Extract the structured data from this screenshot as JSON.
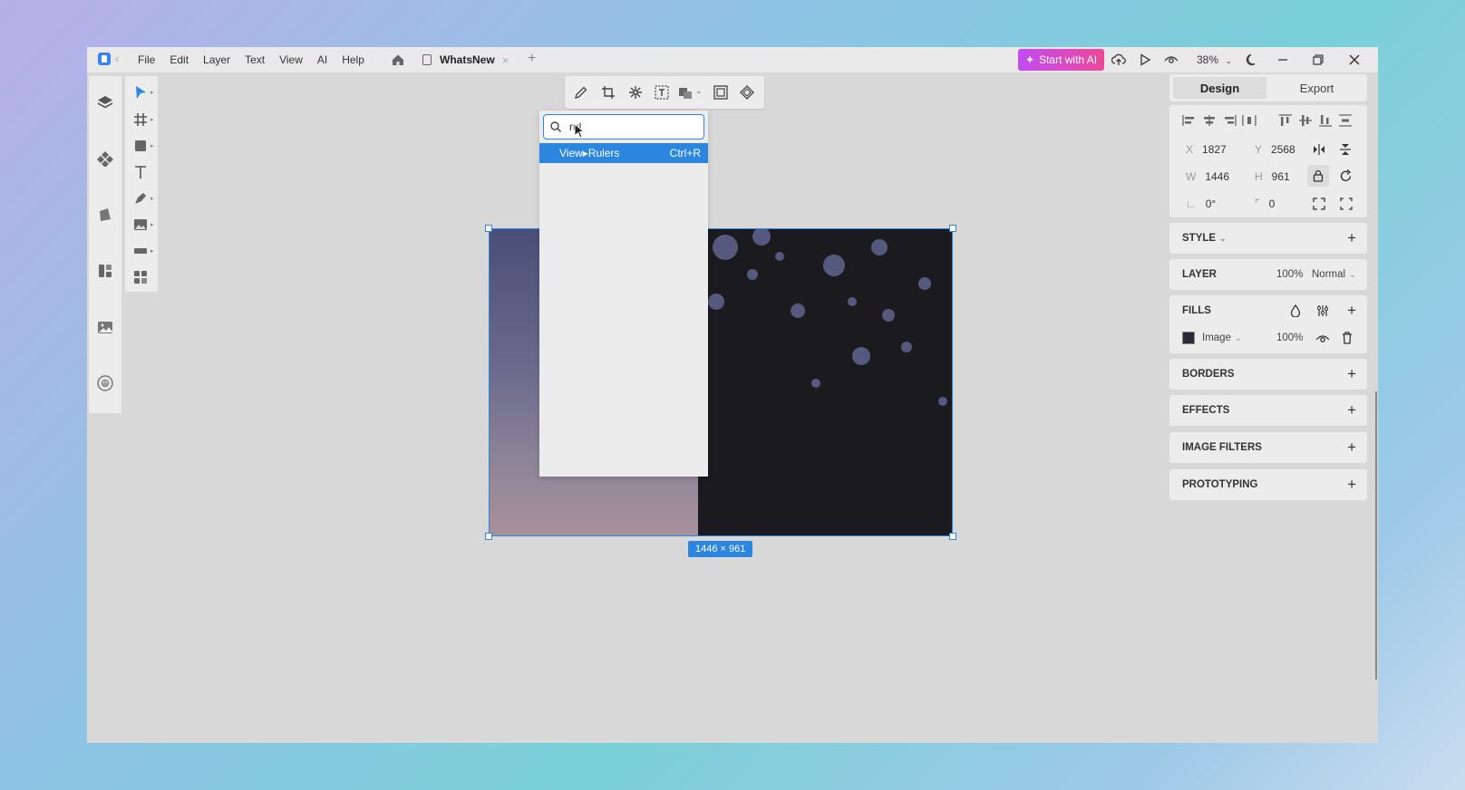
{
  "titlebar": {
    "menu": [
      "File",
      "Edit",
      "Layer",
      "Text",
      "View",
      "AI",
      "Help"
    ],
    "tab_label": "WhatsNew",
    "ai_button": "Start with AI",
    "zoom": "38%"
  },
  "search": {
    "query": "rul",
    "result_label": "View▸Rulers",
    "result_shortcut": "Ctrl+R"
  },
  "canvas": {
    "dimension_badge": "1446 × 961"
  },
  "panel": {
    "tabs": [
      "Design",
      "Export"
    ],
    "x_label": "X",
    "x_value": "1827",
    "y_label": "Y",
    "y_value": "2568",
    "w_label": "W",
    "w_value": "1446",
    "h_label": "H",
    "h_value": "961",
    "rotation_value": "0°",
    "radius_value": "0",
    "style_title": "STYLE",
    "layer_title": "LAYER",
    "layer_opacity": "100%",
    "layer_blend": "Normal",
    "fills_title": "FILLS",
    "fill_type": "Image",
    "fill_opacity": "100%",
    "borders_title": "BORDERS",
    "effects_title": "EFFECTS",
    "image_filters_title": "IMAGE FILTERS",
    "prototyping_title": "PROTOTYPING"
  },
  "colors": {
    "accent": "#2b86e0",
    "ai_gradient_start": "#c24cf2",
    "ai_gradient_end": "#ec4899"
  }
}
